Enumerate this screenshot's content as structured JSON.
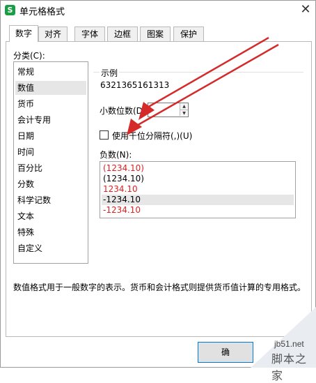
{
  "window": {
    "app_icon_glyph": "S",
    "title": "单元格格式",
    "close_glyph": "✕"
  },
  "tabs": [
    {
      "label": "数字",
      "active": true
    },
    {
      "label": "对齐"
    },
    {
      "label": "字体"
    },
    {
      "label": "边框"
    },
    {
      "label": "图案"
    },
    {
      "label": "保护"
    }
  ],
  "category": {
    "label": "分类(C):",
    "items": [
      "常规",
      "数值",
      "货币",
      "会计专用",
      "日期",
      "时间",
      "百分比",
      "分数",
      "科学记数",
      "文本",
      "特殊",
      "自定义"
    ],
    "selected": "数值"
  },
  "sample": {
    "label": "示例",
    "value": "6321365161313"
  },
  "decimals": {
    "label": "小数位数(D):",
    "value": "",
    "up_glyph": "▲",
    "down_glyph": "▼"
  },
  "thousand_separator": {
    "label": "使用千位分隔符(,)(U)",
    "checked": false
  },
  "negative": {
    "label": "负数(N):",
    "items": [
      {
        "text": "(1234.10)",
        "color": "#e02020"
      },
      {
        "text": "(1234.10)",
        "color": "#000000"
      },
      {
        "text": "1234.10",
        "color": "#e02020"
      },
      {
        "text": "-1234.10",
        "color": "#000000",
        "selected": true
      },
      {
        "text": "-1234.10",
        "color": "#e02020"
      }
    ]
  },
  "description": "数值格式用于一般数字的表示。货币和会计格式则提供货币值计算的专用格式。",
  "buttons": {
    "ok_label": "确"
  },
  "annotation": {
    "arrow_color": "#d42a2a"
  },
  "watermark": {
    "site": "jb51.net",
    "name": "脚本之家"
  }
}
